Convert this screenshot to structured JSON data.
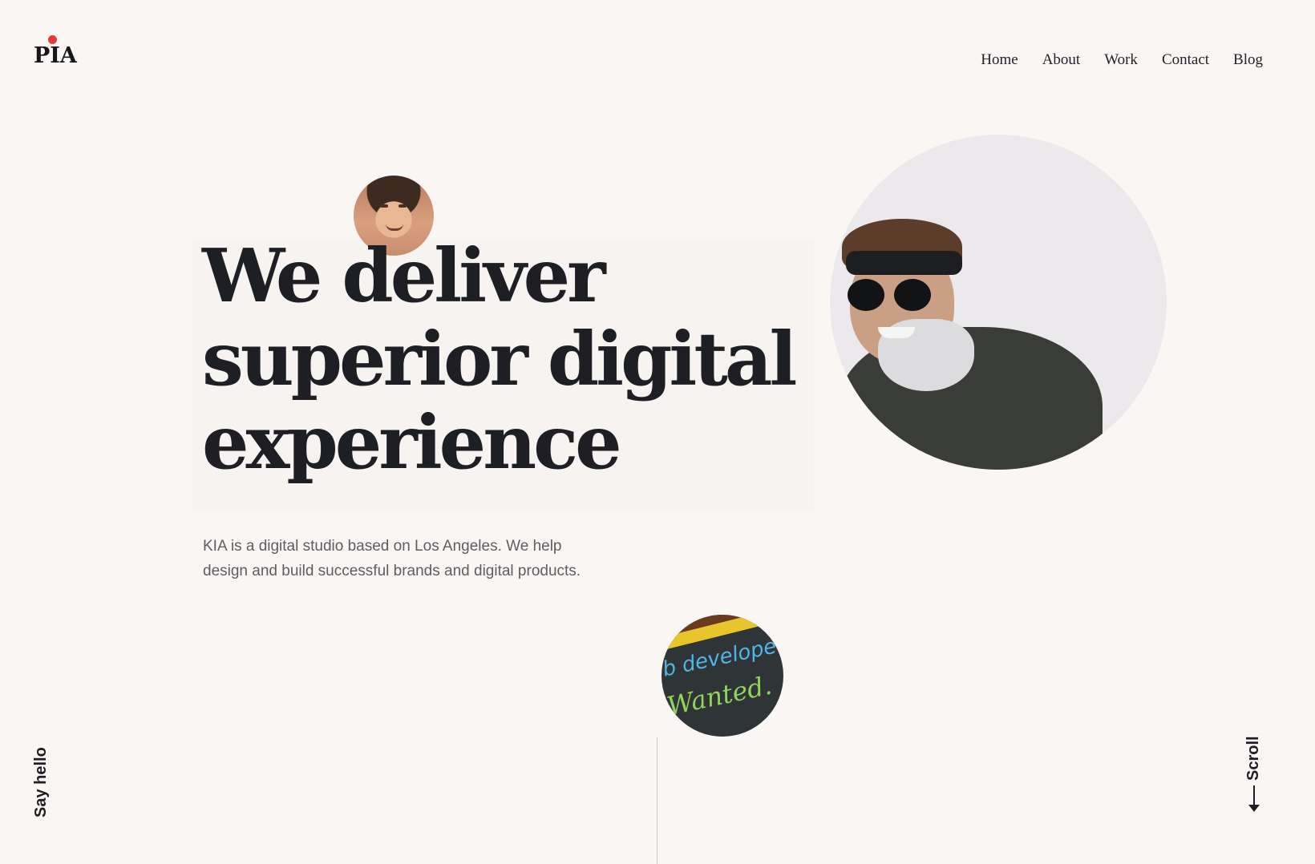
{
  "brand": {
    "logo_text": "PIA",
    "accent_color": "#e03a3a"
  },
  "nav": {
    "items": [
      {
        "label": "Home"
      },
      {
        "label": "About"
      },
      {
        "label": "Work"
      },
      {
        "label": "Contact"
      },
      {
        "label": "Blog"
      }
    ]
  },
  "hero": {
    "headline_line1": "We deliver",
    "headline_line2": "superior digital",
    "headline_line3": "experience",
    "lead_line1": "KIA is a digital studio based on Los Angeles. We help",
    "lead_line2": "design and build successful brands and digital products."
  },
  "images": {
    "chalkboard_text_line1": "b developer",
    "chalkboard_text_line2": "Wanted."
  },
  "side": {
    "say_hello": "Say hello",
    "scroll": "Scroll"
  }
}
